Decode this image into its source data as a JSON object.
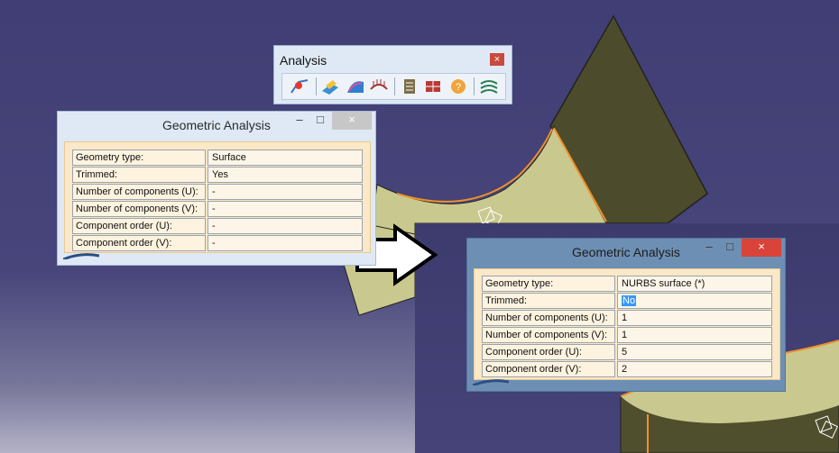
{
  "toolbar": {
    "title": "Analysis",
    "close": "×",
    "tools": [
      {
        "icon": "connect-checker-icon"
      },
      {
        "icon": "draft-analysis-icon"
      },
      {
        "icon": "surface-curvature-icon"
      },
      {
        "icon": "porcupine-curvature-icon"
      },
      {
        "icon": "geometric-information-icon"
      },
      {
        "icon": "mapping-analysis-icon"
      },
      {
        "icon": "cutting-plane-icon"
      },
      {
        "icon": "reflection-lines-icon"
      }
    ]
  },
  "dialog_before": {
    "title": "Geometric Analysis",
    "minimize": "–",
    "maximize": "□",
    "close": "×",
    "rows": [
      {
        "label": "Geometry type:",
        "value": "Surface"
      },
      {
        "label": "Trimmed:",
        "value": "Yes"
      },
      {
        "label": "Number of components (U):",
        "value": "-"
      },
      {
        "label": "Number of components (V):",
        "value": "-"
      },
      {
        "label": "Component order (U):",
        "value": "-"
      },
      {
        "label": "Component order (V):",
        "value": "-"
      }
    ]
  },
  "dialog_after": {
    "title": "Geometric Analysis",
    "minimize": "–",
    "maximize": "□",
    "close": "×",
    "rows": [
      {
        "label": "Geometry type:",
        "value": "NURBS surface (*)"
      },
      {
        "label": "Trimmed:",
        "value": "No"
      },
      {
        "label": "Number of components (U):",
        "value": "1"
      },
      {
        "label": "Number of components (V):",
        "value": "1"
      },
      {
        "label": "Component order (U):",
        "value": "5"
      },
      {
        "label": "Component order (V):",
        "value": "2"
      }
    ]
  },
  "colors": {
    "background": "#3f3d72",
    "surface": "#c9c98f",
    "surface_dark": "#4f4f2e",
    "edge_highlight": "#f0902a",
    "selection": "#3399ff"
  }
}
